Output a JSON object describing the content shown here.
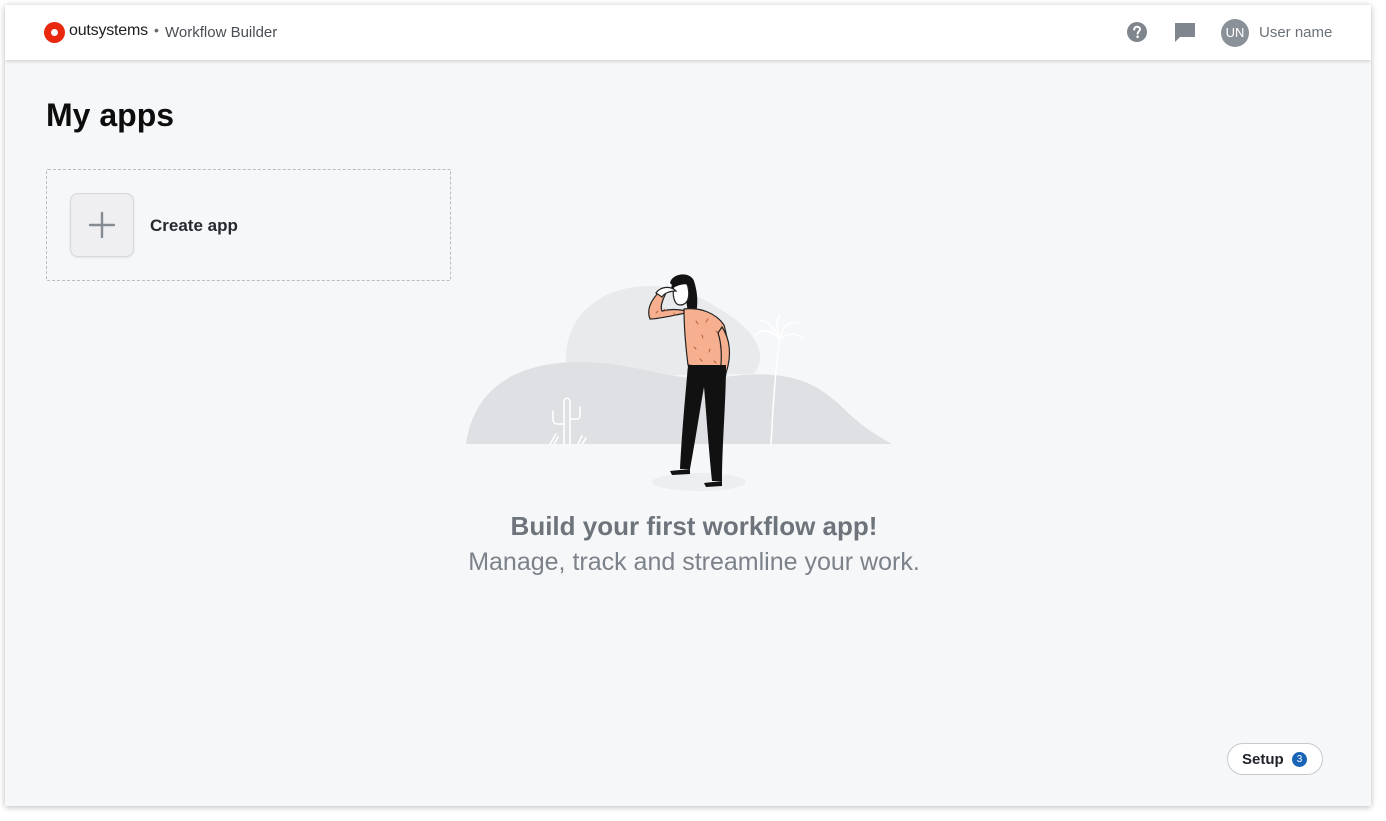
{
  "header": {
    "brand": "outsystems",
    "separator": "•",
    "product": "Workflow Builder",
    "help_icon": "question-circle-icon",
    "chat_icon": "chat-bubble-icon",
    "avatar_initials": "UN",
    "user_name": "User name"
  },
  "main": {
    "title": "My apps",
    "create_app_label": "Create app",
    "empty_state": {
      "title": "Build your first workflow app!",
      "subtitle": "Manage, track and streamline your work."
    }
  },
  "footer": {
    "setup_label": "Setup",
    "setup_count": "3"
  },
  "colors": {
    "brand_red": "#e8280f",
    "badge_blue": "#1a64b8",
    "page_bg": "#f6f7f9"
  }
}
